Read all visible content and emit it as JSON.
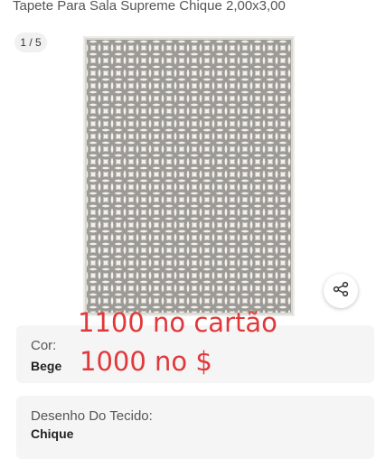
{
  "product": {
    "title": "Tapete Para Sala Supreme Chique 2,00x3,00",
    "gallery_counter": "1 / 5",
    "share_icon": "share-icon"
  },
  "attributes": [
    {
      "label": "Cor:",
      "value": "Bege"
    },
    {
      "label": "Desenho Do Tecido:",
      "value": "Chique"
    }
  ],
  "handwritten_notes": {
    "card_price": "1100 no cartão",
    "cash_price": "1000 no $"
  },
  "colors": {
    "note": "#e0383b",
    "rug_background": "#f3f1ea",
    "rug_pattern": "#9c9a96"
  }
}
